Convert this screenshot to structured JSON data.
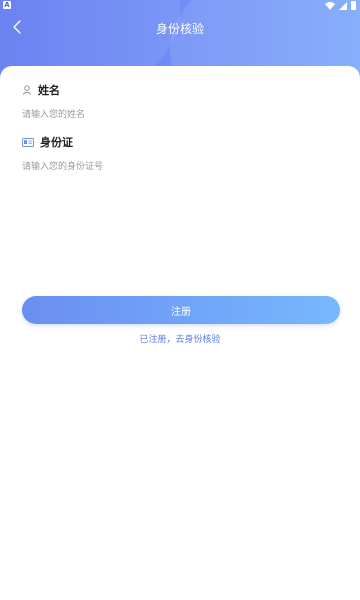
{
  "statusbar": {
    "left_badge": "A"
  },
  "header": {
    "title": "身份核验"
  },
  "form": {
    "name": {
      "label": "姓名",
      "placeholder": "请输入您的姓名"
    },
    "id_card": {
      "label": "身份证",
      "placeholder": "请输入您的身份证号"
    }
  },
  "actions": {
    "register_label": "注册",
    "verify_link": "已注册，去身份核验"
  },
  "icons": {
    "back": "chevron-left-icon",
    "name": "user-icon",
    "id_card": "id-card-icon"
  },
  "colors": {
    "header_gradient_start": "#5f78f0",
    "header_gradient_end": "#7aa6fb",
    "button_gradient_start": "#6a8ef2",
    "button_gradient_end": "#77b8fd",
    "link": "#5a7ae6"
  }
}
